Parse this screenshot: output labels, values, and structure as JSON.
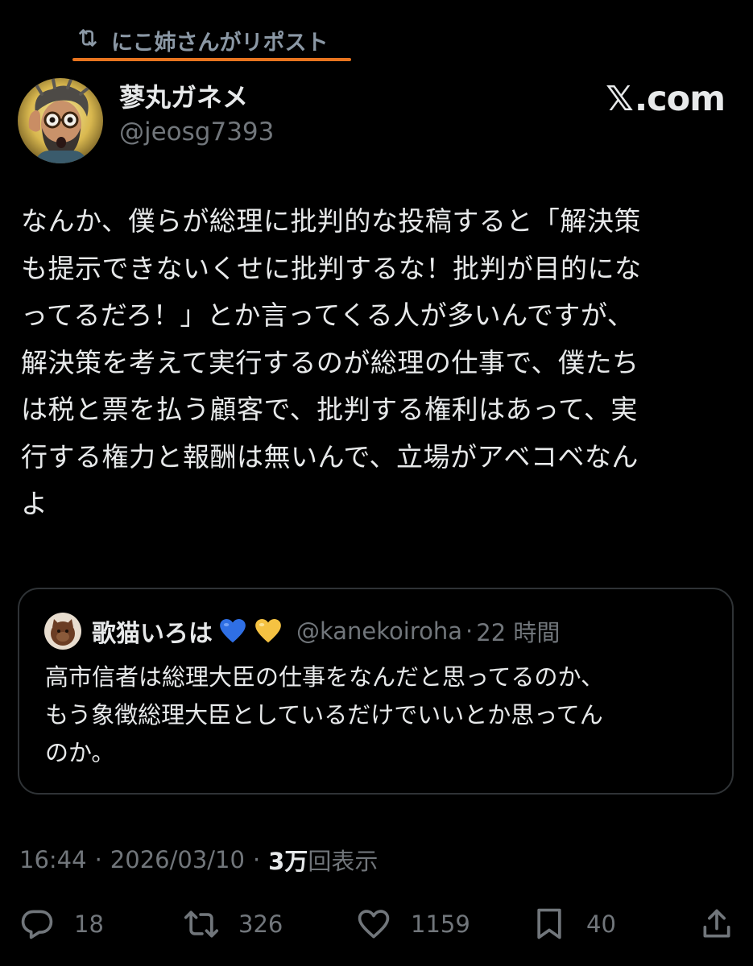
{
  "repost_banner": {
    "icon": "repost-icon",
    "label": "にこ姉さんがリポスト",
    "underline_color": "#e8741f"
  },
  "author": {
    "name": "蓼丸ガネメ",
    "handle": "@jeosg7393",
    "avatar": "cartoon-man-with-glasses-avatar"
  },
  "brand_watermark": {
    "mark": "𝕏",
    "suffix": ".com"
  },
  "tweet": {
    "lines": [
      "なんか、僕らが総理に批判的な投稿すると「解決策",
      "も提示できないくせに批判するな！批判が目的にな",
      "ってるだろ！」とか言ってくる人が多いんですが、",
      "解決策を考えて実行するのが総理の仕事で、僕たち",
      "は税と票を払う顧客で、批判する権利はあって、実",
      "行する権力と報酬は無いんで、立場がアベコベなん",
      "よ"
    ]
  },
  "quote": {
    "avatar": "cat-avatar",
    "name": "歌猫いろは",
    "emojis": [
      "blue-heart-icon",
      "yellow-heart-icon"
    ],
    "handle": "@kanekoiroha",
    "separator": "·",
    "time": "22 時間",
    "lines": [
      "高市信者は総理大臣の仕事をなんだと思ってるのか、",
      "もう象徴総理大臣としているだけでいいとか思ってん",
      "のか。"
    ]
  },
  "meta": {
    "time": "16:44",
    "dot": "·",
    "date": "2026/03/10",
    "views_count": "3万",
    "views_label": "回表示"
  },
  "actions": {
    "reply": {
      "icon": "reply-icon",
      "count": "18"
    },
    "repost": {
      "icon": "repost-icon",
      "count": "326"
    },
    "like": {
      "icon": "heart-icon",
      "count": "1159"
    },
    "bookmark": {
      "icon": "bookmark-icon",
      "count": "40"
    },
    "share": {
      "icon": "share-icon"
    }
  },
  "colors": {
    "background": "#000000",
    "text_primary": "#e7e9ea",
    "text_secondary": "#71767b",
    "border": "#2f3336",
    "accent_underline": "#e8741f",
    "blue_heart": "#2f6fe4",
    "yellow_heart": "#f5c242"
  }
}
